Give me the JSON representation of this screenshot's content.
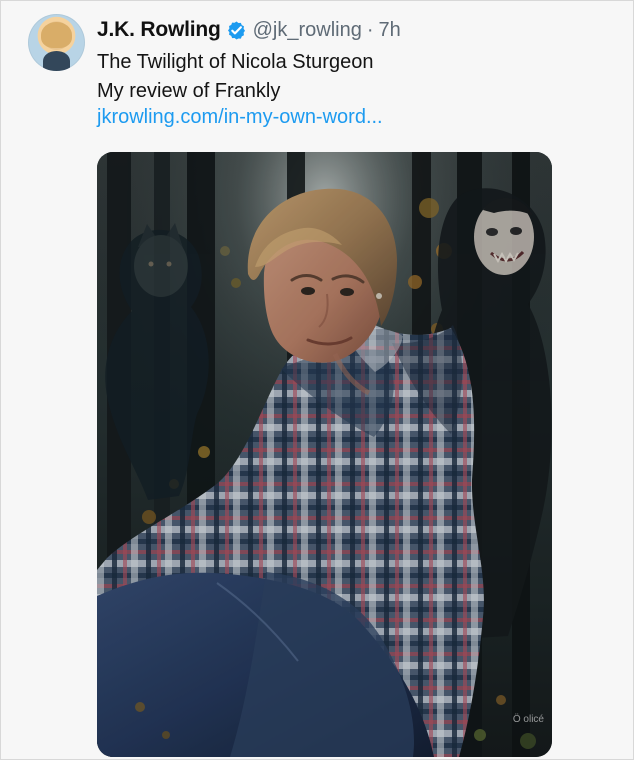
{
  "tweet": {
    "display_name": "J.K. Rowling",
    "handle": "@jk_rowling",
    "separator": "·",
    "time": "7h",
    "lines": [
      "The Twilight of Nicola Sturgeon",
      "My review of Frankly"
    ],
    "link_text": "jkrowling.com/in-my-own-word...",
    "verified_icon": "verified-badge-icon",
    "accent_color": "#1d9bf0"
  },
  "media": {
    "watermark": "Ö olicé"
  }
}
